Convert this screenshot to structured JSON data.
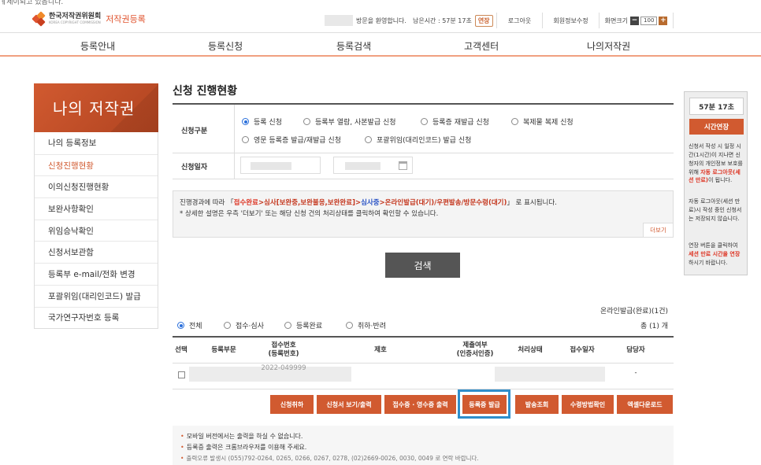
{
  "top_partial_text": "ㅔ세이되고 었읍니다.",
  "header": {
    "logo_ko": "한국저작권위원회",
    "logo_en": "KOREA COPYRIGHT COMMISSION",
    "logo_sub": "저작권등록",
    "welcome": "방문을 환영합니다.",
    "remaining_label": "남은시간 : 57분 17초",
    "extend_label": "연장",
    "logout": "로그아웃",
    "member_edit": "회원정보수정",
    "zoom_label": "화면크기",
    "zoom_value": "100",
    "zoom_minus": "−",
    "zoom_plus": "+"
  },
  "nav": [
    "등록안내",
    "등록신청",
    "등록검색",
    "고객센터",
    "나의저작권"
  ],
  "sidebar": {
    "banner": "나의 저작권",
    "items": [
      {
        "label": "나의 등록정보",
        "active": false
      },
      {
        "label": "신청진행현황",
        "active": true
      },
      {
        "label": "이의신청진행현황",
        "active": false
      },
      {
        "label": "보완사항확인",
        "active": false
      },
      {
        "label": "위임승낙확인",
        "active": false
      },
      {
        "label": "신청서보관함",
        "active": false
      },
      {
        "label": "등록부 e-mail/전화 변경",
        "active": false
      },
      {
        "label": "포괄위임(대리인코드) 발급",
        "active": false
      },
      {
        "label": "국가연구자번호 등록",
        "active": false
      }
    ]
  },
  "main": {
    "title": "신청 진행현황",
    "form": {
      "type_label": "신청구분",
      "date_label": "신청일자",
      "types": [
        {
          "label": "등록 신청",
          "checked": true
        },
        {
          "label": "등록부 열람, 사본발급 신청",
          "checked": false
        },
        {
          "label": "등록증 재발급 신청",
          "checked": false
        },
        {
          "label": "복제물 복제 신청",
          "checked": false
        },
        {
          "label": "영문 등록증 발급/재발급 신청",
          "checked": false
        },
        {
          "label": "포괄위임(대리인코드) 발급 신청",
          "checked": false
        }
      ]
    },
    "info": {
      "line1_prefix": "진행경과에 따라 「",
      "s1": "접수완료",
      "s2": ">심사[보완중,보완불응,보완완료]>",
      "s3": "심사중",
      "s4": ">온라인발급(대기)/우편발송/방문수령(대기)",
      "line1_suffix": "」 로 표시됩니다.",
      "line2": "* 상세한 설명은 우측 '더보기' 또는 해당 신청 건의 처리상태를 클릭하여 확인할 수 있습니다.",
      "more": "더보기"
    },
    "search_button": "검색",
    "online_count": "온라인발급(완료)(1건)",
    "filters": [
      {
        "label": "전체",
        "checked": true
      },
      {
        "label": "접수·심사",
        "checked": false
      },
      {
        "label": "등록완료",
        "checked": false
      },
      {
        "label": "취하·반려",
        "checked": false
      }
    ],
    "total": "총 (1) 개",
    "table": {
      "headers": [
        "선택",
        "등록부문",
        "접수번호\n(등록번호)",
        "제호",
        "제출여부\n(인증서인증)",
        "처리상태",
        "접수일자",
        "담당자"
      ],
      "row_reg_no": "2022-049999",
      "row_manager": "-"
    },
    "actions": [
      "신청취하",
      "신청서 보기/출력",
      "접수증 · 영수증 출력",
      "등록증 발급",
      "발송조회",
      "수령방법확인",
      "엑셀다운로드"
    ],
    "notes": [
      "모바일 버전에서는 출력을 하실 수 없습니다.",
      "등록증 출력은 크롬브라우저를 이용해 주세요.",
      "출력오류 발생시 (055)792-0264, 0265, 0266, 0267, 0278, (02)2669-0026, 0030, 0049 로 연락 바랍니다."
    ]
  },
  "session": {
    "time": "57분 17초",
    "extend": "시간연장",
    "p1_a": "신청서 작성 시 일정 시간(1시간)이 지나면 신청자의 개인정보 보호를 위해 ",
    "p1_r": "자동 로그아웃(세션 만료)",
    "p1_b": "이 됩니다.",
    "p2": "자동 로그아웃(세션 만료)시 작성 중인 신청서는 저장되지 않습니다.",
    "p3_a": "연장 버튼을 클릭하여 ",
    "p3_r": "세션 만료 시간을 연장",
    "p3_b": "하시기 바랍니다."
  },
  "colors": {
    "accent": "#d15a30",
    "focus": "#2f8ecb",
    "search": "#555555"
  }
}
